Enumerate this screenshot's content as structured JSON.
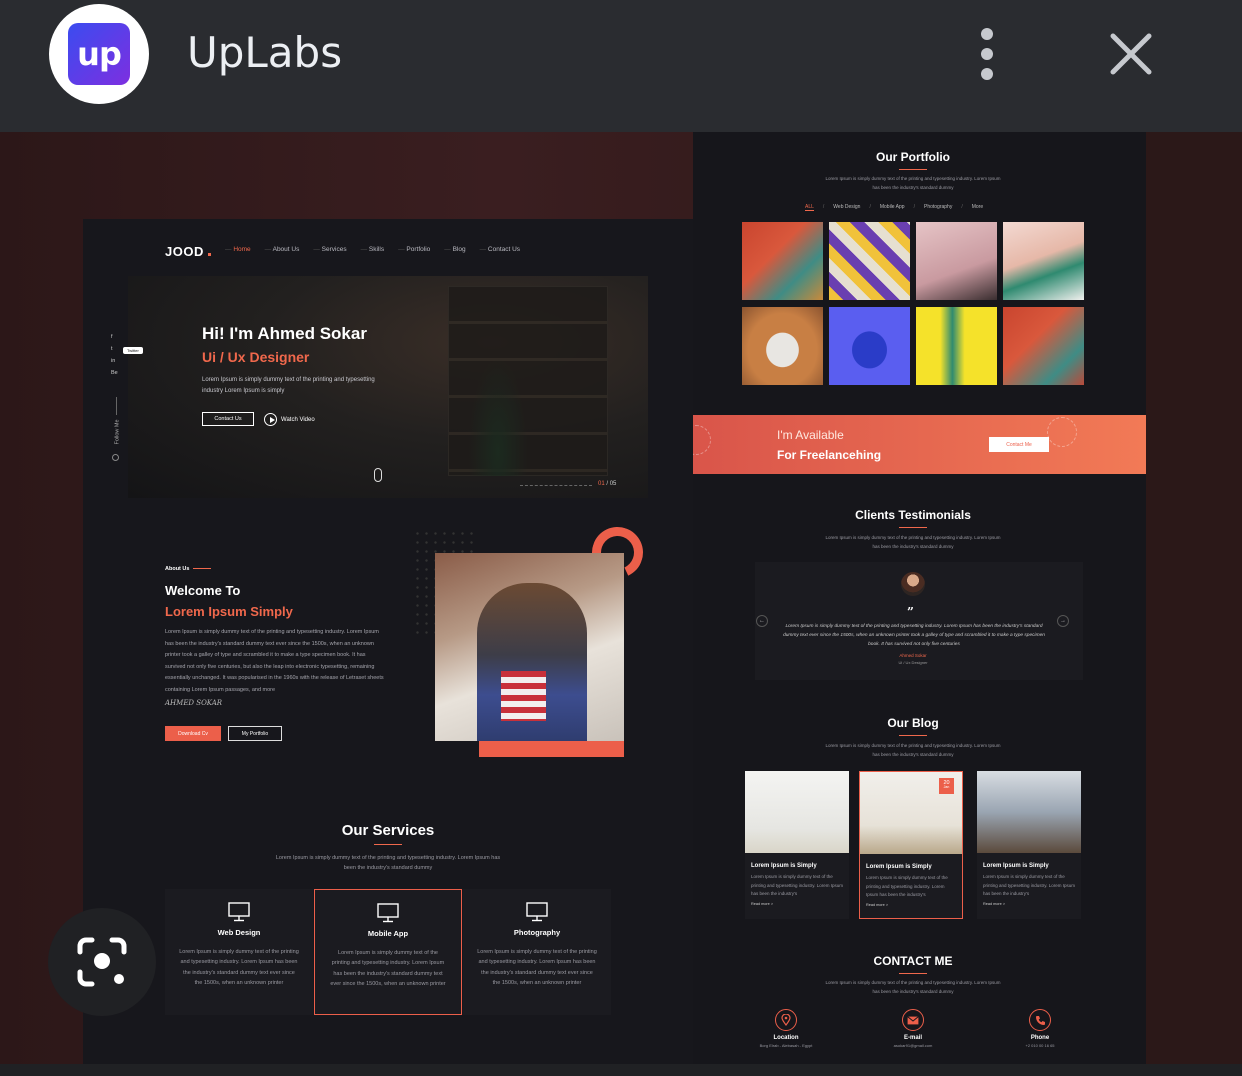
{
  "app": {
    "logo_text": "up",
    "title": "UpLabs"
  },
  "left_page": {
    "brand": "JOOD",
    "nav": [
      "Home",
      "About Us",
      "Services",
      "Skills",
      "Portfolio",
      "Blog",
      "Contact Us"
    ],
    "social": [
      "f",
      "t",
      "in",
      "Be"
    ],
    "social_badge": "Twitter",
    "follow_label": "Follow Me",
    "hero": {
      "title": "Hi! I'm Ahmed Sokar",
      "subtitle": "Ui / Ux Designer",
      "description": "Lorem Ipsum is simply dummy text of the printing and typesetting industry Lorem Ipsum is simply",
      "contact_button": "Contact Us",
      "watch_label": "Watch Video",
      "slide_current": "01",
      "slide_total": " / 05"
    },
    "about": {
      "label": "About Us",
      "heading1": "Welcome To",
      "heading2": "Lorem Ipsum Simply",
      "text": "Lorem Ipsum is simply dummy text of the printing and typesetting industry. Lorem Ipsum has been the industry's standard dummy text ever since the 1500s, when an unknown printer took a galley of type and scrambled it to make a type specimen book. It has survived not only five centuries, but also the leap into electronic typesetting, remaining essentially unchanged. It was popularised in the 1960s with the release of Letraset sheets containing Lorem Ipsum passages, and more",
      "signature": "AHMED SOKAR",
      "download_button": "Download Cv",
      "portfolio_button": "My Portfolio"
    },
    "services": {
      "title": "Our Services",
      "subtitle": "Lorem Ipsum is simply dummy text of the printing and typesetting industry. Lorem Ipsum has been the industry's standard dummy",
      "cards": [
        {
          "name": "Web Design",
          "text": "Lorem Ipsum is simply dummy text of the printing and typesetting industry. Lorem Ipsum has been the industry's standard dummy text ever since the 1500s, when an unknown printer"
        },
        {
          "name": "Mobile App",
          "text": "Lorem Ipsum is simply dummy text of the printing and typesetting industry. Lorem Ipsum has been the industry's standard dummy text ever since the 1500s, when an unknown printer"
        },
        {
          "name": "Photography",
          "text": "Lorem Ipsum is simply dummy text of the printing and typesetting industry. Lorem Ipsum has been the industry's standard dummy text ever since the 1500s, when an unknown printer"
        }
      ]
    }
  },
  "right_page": {
    "portfolio": {
      "title": "Our Portfolio",
      "subtitle": "Lorem Ipsum is simply dummy text of the printing and typesetting industry. Lorem Ipsum has been the industry's standard dummy",
      "tabs": [
        "ALL",
        "Web Design",
        "Mobile App",
        "Photography",
        "More"
      ]
    },
    "banner": {
      "line1": "I'm Available",
      "line2": "For Freelancehing",
      "button": "Contact Me"
    },
    "testimonials": {
      "title": "Clients Testimonials",
      "subtitle": "Lorem Ipsum is simply dummy text of the printing and typesetting industry. Lorem Ipsum has been the industry's standard dummy",
      "quote_mark": "”",
      "text": "Lorem Ipsum is simply dummy text of the printing and typesetting industry. Lorem Ipsum has been the industry's standard dummy text ever since the 1500s, when an unknown printer took a galley of type and scrambled it to make a type specimen book. It has survived not only five centuries",
      "name": "Ahmed Sokar",
      "role": "Ui / Ux Designer"
    },
    "blog": {
      "title": "Our Blog",
      "subtitle": "Lorem Ipsum is simply dummy text of the printing and typesetting industry. Lorem Ipsum has been the industry's standard dummy",
      "date_day": "20",
      "date_month": "Jan",
      "cards": [
        {
          "title": "Lorem Ipsum is Simply",
          "text": "Lorem Ipsum is simply dummy text of the printing and typesetting industry. Lorem Ipsum has been the industry's",
          "more": "Read more >"
        },
        {
          "title": "Lorem Ipsum is Simply",
          "text": "Lorem Ipsum is simply dummy text of the printing and typesetting industry. Lorem Ipsum has been the industry's",
          "more": "Read more >"
        },
        {
          "title": "Lorem Ipsum is Simply",
          "text": "Lorem Ipsum is simply dummy text of the printing and typesetting industry. Lorem Ipsum has been the industry's",
          "more": "Read more >"
        }
      ]
    },
    "contact": {
      "title": "CONTACT ME",
      "subtitle": "Lorem Ipsum is simply dummy text of the printing and typesetting industry. Lorem Ipsum has been the industry's standard dummy",
      "items": [
        {
          "label": "Location",
          "value": "Borg Elrab - Alebasah - Egypt"
        },
        {
          "label": "E-mail",
          "value": "asokar91@gmail.com"
        },
        {
          "label": "Phone",
          "value": "+2 010 00 16 65"
        }
      ]
    }
  },
  "colors": {
    "accent": "#ec5f4a",
    "background": "#17171c",
    "topbar": "#2a2c30"
  }
}
